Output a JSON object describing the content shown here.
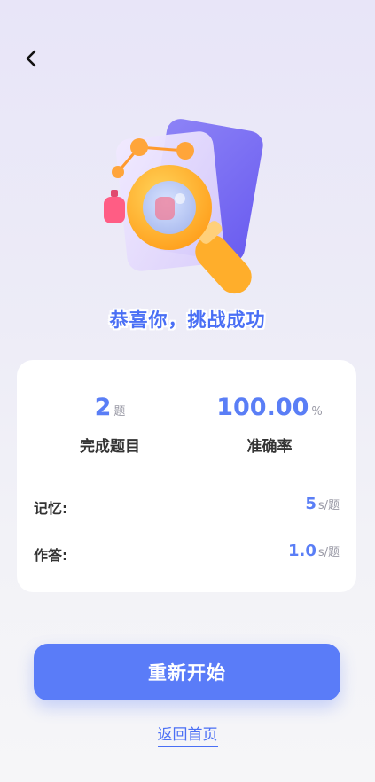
{
  "header": {
    "back_icon": "chevron-left-icon"
  },
  "hero": {
    "icon": "magnifier-document-illustration"
  },
  "headline": "恭喜你，挑战成功",
  "stats": [
    {
      "value": "2",
      "unit": "题",
      "label": "完成题目"
    },
    {
      "value": "100.00",
      "unit": "%",
      "label": "准确率"
    }
  ],
  "details": [
    {
      "label": "记忆:",
      "value": "5",
      "unit": "s/题"
    },
    {
      "label": "作答:",
      "value": "1.0",
      "unit": "s/题"
    }
  ],
  "actions": {
    "restart_label": "重新开始",
    "home_label": "返回首页"
  },
  "colors": {
    "accent": "#5a7cf8",
    "accent_text": "#4a6ff5",
    "muted": "#9a9aa6"
  }
}
